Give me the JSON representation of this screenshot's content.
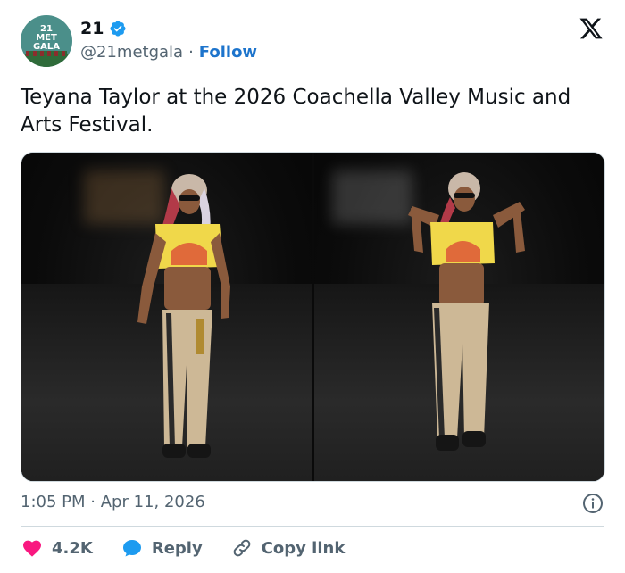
{
  "author": {
    "avatar_text": "21\nMET\nGALA",
    "display_name": "21",
    "handle": "@21metgala",
    "separator": "·",
    "follow_label": "Follow"
  },
  "tweet": {
    "text": "Teyana Taylor at the 2026 Coachella Valley Music and Arts Festival.",
    "time": "1:05 PM",
    "date_separator": "·",
    "date": "Apr 11, 2026"
  },
  "actions": {
    "like_count": "4.2K",
    "reply_label": "Reply",
    "copy_link_label": "Copy link"
  },
  "colors": {
    "accent": "#1d9bf0",
    "like": "#f91880",
    "text_secondary": "#536471"
  },
  "icons": [
    "verified-badge-icon",
    "x-logo-icon",
    "info-icon",
    "heart-icon",
    "reply-bubble-icon",
    "link-icon"
  ]
}
